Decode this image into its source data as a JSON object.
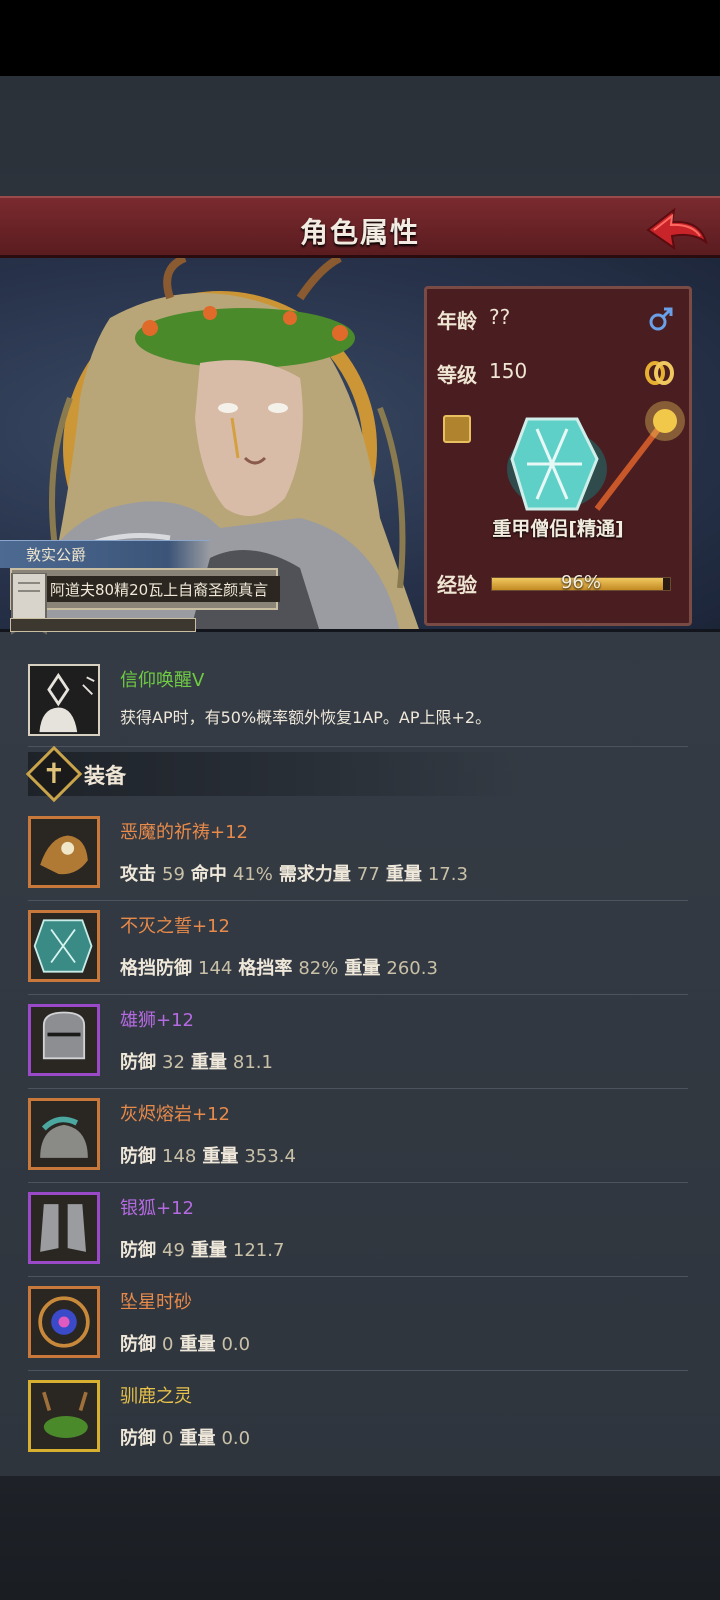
{
  "header": {
    "title": "角色属性"
  },
  "character": {
    "title_tag": "敦实公爵",
    "bio": "阿道夫80精20瓦上自裔圣颜真言"
  },
  "stats": {
    "age_label": "年龄",
    "age_value": "??",
    "level_label": "等级",
    "level_value": "150",
    "class_name": "重甲僧侣[精通]",
    "exp_label": "经验",
    "exp_value": "96%",
    "exp_fraction": 0.96
  },
  "skill": {
    "name": "信仰唤醒V",
    "desc": "获得AP时，有50%概率额外恢复1AP。AP上限+2。"
  },
  "equipment": {
    "title": "装备",
    "items": [
      {
        "name": "恶魔的祈祷+12",
        "color": "#e88a4a",
        "border": "#c8783a",
        "stats": [
          [
            "攻击",
            "59"
          ],
          [
            "命中",
            "41%"
          ],
          [
            "需求力量",
            "77"
          ],
          [
            "重量",
            "17.3"
          ]
        ]
      },
      {
        "name": "不灭之誓+12",
        "color": "#e88a4a",
        "border": "#c8783a",
        "stats": [
          [
            "格挡防御",
            "144"
          ],
          [
            "格挡率",
            "82%"
          ],
          [
            "重量",
            "260.3"
          ]
        ]
      },
      {
        "name": "雄狮+12",
        "color": "#b46ae0",
        "border": "#9a4ac8",
        "stats": [
          [
            "防御",
            "32"
          ],
          [
            "重量",
            "81.1"
          ]
        ]
      },
      {
        "name": "灰烬熔岩+12",
        "color": "#e88a4a",
        "border": "#c8783a",
        "stats": [
          [
            "防御",
            "148"
          ],
          [
            "重量",
            "353.4"
          ]
        ]
      },
      {
        "name": "银狐+12",
        "color": "#b46ae0",
        "border": "#9a4ac8",
        "stats": [
          [
            "防御",
            "49"
          ],
          [
            "重量",
            "121.7"
          ]
        ]
      },
      {
        "name": "坠星时砂",
        "color": "#e88a4a",
        "border": "#c8783a",
        "stats": [
          [
            "防御",
            "0"
          ],
          [
            "重量",
            "0.0"
          ]
        ]
      },
      {
        "name": "驯鹿之灵",
        "color": "#e8c24a",
        "border": "#d8b030",
        "stats": [
          [
            "防御",
            "0"
          ],
          [
            "重量",
            "0.0"
          ]
        ]
      }
    ]
  }
}
